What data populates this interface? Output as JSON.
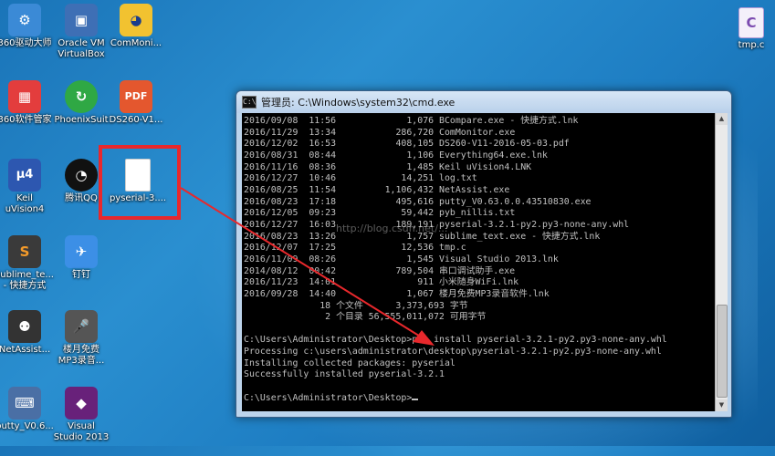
{
  "desktop": {
    "icons": [
      {
        "id": "360-driver",
        "label": "360驱动大师",
        "glyph": "⚙",
        "bg": "#3b8ad6"
      },
      {
        "id": "virtualbox",
        "label": "Oracle VM\nVirtualBox",
        "glyph": "▣",
        "bg": "#3e6fb5"
      },
      {
        "id": "commonitor",
        "label": "ComMoni...",
        "glyph": "◕",
        "bg": "#f2c230"
      },
      {
        "id": "360-software",
        "label": "360软件管家",
        "glyph": "▦",
        "bg": "#e33d3d"
      },
      {
        "id": "phoenixsuit",
        "label": "PhoenixSuit",
        "glyph": "↻",
        "bg": "#2fa844"
      },
      {
        "id": "ds260",
        "label": "DS260-V1...",
        "glyph": "PDF",
        "bg": "#e4572e"
      },
      {
        "id": "keil",
        "label": "Keil\nuVision4",
        "glyph": "μ4",
        "bg": "#2d57b0"
      },
      {
        "id": "qq",
        "label": "腾讯QQ",
        "glyph": "◔",
        "bg": "#111111"
      },
      {
        "id": "pyserial",
        "label": "pyserial-3....",
        "glyph": "",
        "bg": "#ffffff"
      },
      {
        "id": "sublime",
        "label": "sublime_te...\n- 快捷方式",
        "glyph": "S",
        "bg": "#3a3a3a"
      },
      {
        "id": "dingding",
        "label": "钉钉",
        "glyph": "✈",
        "bg": "#3c8fe6"
      },
      {
        "id": "netassist",
        "label": "NetAssist...",
        "glyph": "⚉",
        "bg": "#333333"
      },
      {
        "id": "mp3-recorder",
        "label": "楼月免费\nMP3录音...",
        "glyph": "🎤",
        "bg": "#555555"
      },
      {
        "id": "putty",
        "label": "putty_V0.6...",
        "glyph": "⌨",
        "bg": "#4a6fa5"
      },
      {
        "id": "visual-studio",
        "label": "Visual\nStudio 2013",
        "glyph": "◆",
        "bg": "#68217a"
      },
      {
        "id": "tmp-c",
        "label": "tmp.c",
        "glyph": "C",
        "bg": "#f4f0fa"
      }
    ]
  },
  "cmd": {
    "title": "管理员: C:\\Windows\\system32\\cmd.exe",
    "title_icon": "C:\\",
    "lines": [
      "2016/09/08  11:56             1,076 BCompare.exe - 快捷方式.lnk",
      "2016/11/29  13:34           286,720 ComMonitor.exe",
      "2016/12/02  16:53           408,105 DS260-V11-2016-05-03.pdf",
      "2016/08/31  08:44             1,106 Everything64.exe.lnk",
      "2016/11/16  08:36             1,485 Keil uVision4.LNK",
      "2016/12/27  10:46            14,251 log.txt",
      "2016/08/25  11:54         1,106,432 NetAssist.exe",
      "2016/08/23  17:18           495,616 putty_V0.63.0.0.43510830.exe",
      "2016/12/05  09:23            59,442 pyb_nillis.txt",
      "2016/12/27  16:03           189,191 pyserial-3.2.1-py2.py3-none-any.whl",
      "2016/08/23  13:26             1,757 sublime_text.exe - 快捷方式.lnk",
      "2016/12/07  17:25            12,536 tmp.c",
      "2016/11/09  08:26             1,545 Visual Studio 2013.lnk",
      "2014/08/12  00:42           789,504 串口调试助手.exe",
      "2016/11/23  14:01               911 小米随身WiFi.lnk",
      "2016/09/28  14:40             1,067 楼月免费MP3录音软件.lnk",
      "              18 个文件      3,373,693 字节",
      "               2 个目录 56,555,011,072 可用字节",
      "",
      "C:\\Users\\Administrator\\Desktop>pip install pyserial-3.2.1-py2.py3-none-any.whl",
      "Processing c:\\users\\administrator\\desktop\\pyserial-3.2.1-py2.py3-none-any.whl",
      "Installing collected packages: pyserial",
      "Successfully installed pyserial-3.2.1",
      "",
      "C:\\Users\\Administrator\\Desktop>"
    ],
    "watermark": "http://blog.csdn.net/..."
  },
  "colors": {
    "highlight": "#e8282c",
    "console_bg": "#000000",
    "console_fg": "#c0c0c0"
  }
}
